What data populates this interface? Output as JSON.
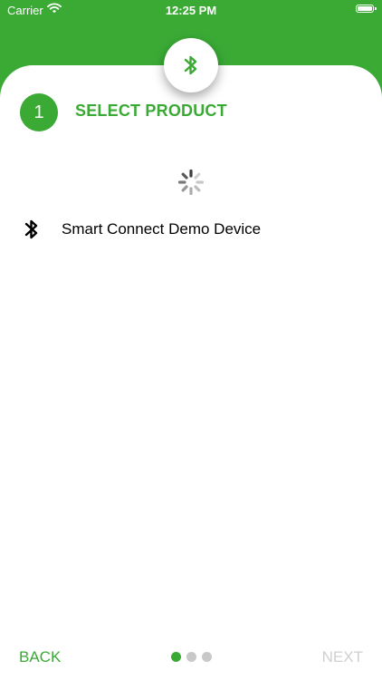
{
  "status_bar": {
    "carrier": "Carrier",
    "time": "12:25 PM",
    "icons": [
      "wifi-icon",
      "battery-icon"
    ]
  },
  "header": {
    "badge_icon": "bluetooth-icon"
  },
  "step": {
    "number": "1",
    "title": "SELECT PRODUCT"
  },
  "devices": [
    {
      "icon": "bluetooth-icon",
      "name": "Smart Connect Demo Device"
    }
  ],
  "footer": {
    "back_label": "BACK",
    "next_label": "NEXT",
    "page_count": 3,
    "current_page": 1
  },
  "colors": {
    "brand_green": "#3aaa35",
    "disabled_text": "#d0d0d0",
    "inactive_dot": "#c8c8c8"
  }
}
